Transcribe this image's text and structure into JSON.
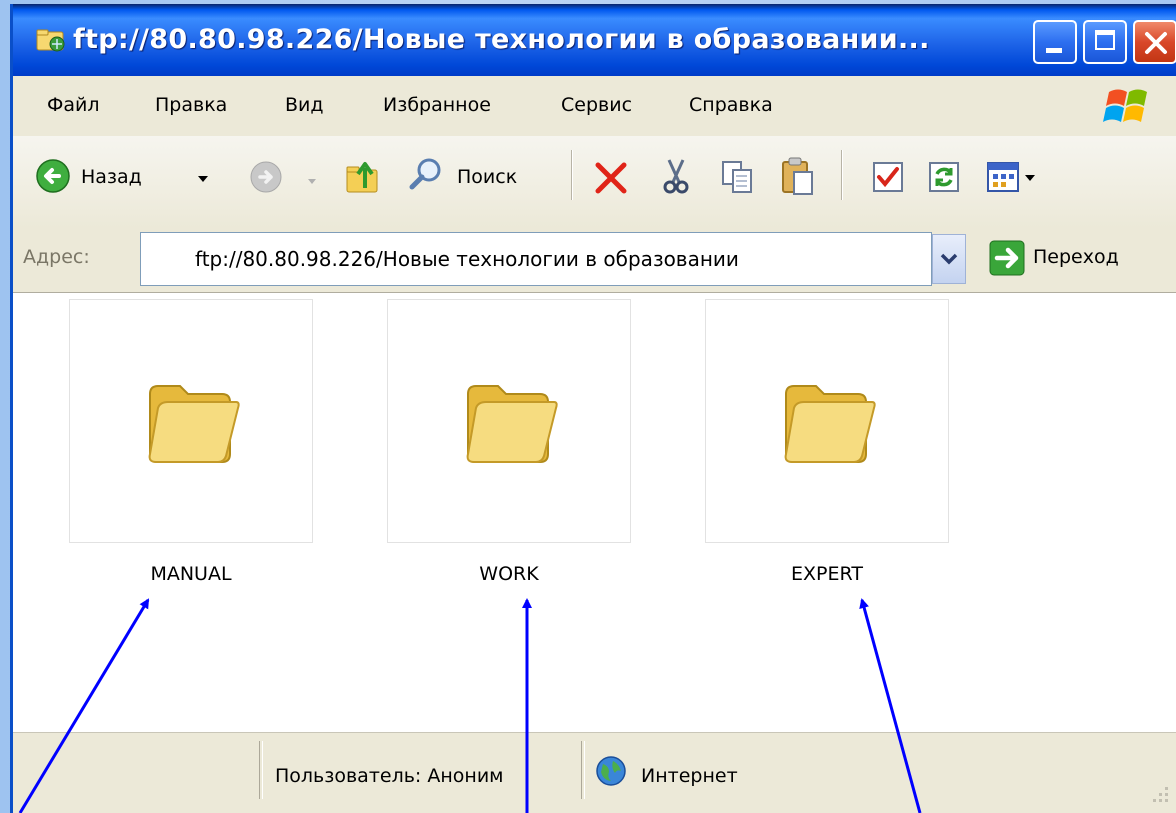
{
  "window": {
    "title": "ftp://80.80.98.226/Новые технологии  в образовании..."
  },
  "menu": {
    "items": [
      {
        "label": "Файл"
      },
      {
        "label": "Правка"
      },
      {
        "label": "Вид"
      },
      {
        "label": "Избранное"
      },
      {
        "label": "Сервис"
      },
      {
        "label": "Справка"
      }
    ]
  },
  "toolbar": {
    "back_label": "Назад",
    "search_label": "Поиск",
    "icons": [
      "back-icon",
      "forward-icon",
      "up-folder-icon",
      "search-icon",
      "delete-icon",
      "cut-icon",
      "copy-icon",
      "paste-icon",
      "properties-icon",
      "refresh-icon",
      "views-icon"
    ]
  },
  "address": {
    "label": "Адрес:",
    "value": "ftp://80.80.98.226/Новые технологии в образовании",
    "go_label": "Переход"
  },
  "folders": [
    {
      "name": "MANUAL"
    },
    {
      "name": "WORK"
    },
    {
      "name": "EXPERT"
    }
  ],
  "status": {
    "user": "Пользователь: Аноним",
    "zone": "Интернет"
  },
  "colors": {
    "titlebar": "#0058ee",
    "chrome": "#ece9d8",
    "arrows": "#0000ff",
    "folder": "#f3d36b"
  }
}
